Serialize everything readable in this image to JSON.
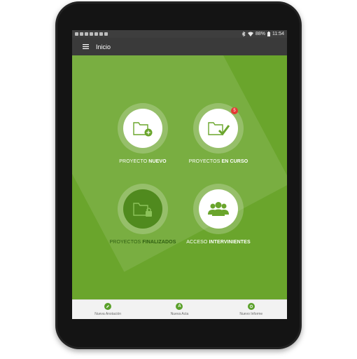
{
  "status_bar": {
    "battery": "88%",
    "time": "11:54"
  },
  "app_bar": {
    "title": "Inicio",
    "menu_icon": "hamburger-menu-icon"
  },
  "tiles": [
    {
      "id": "nuevo",
      "label_prefix": "PROYECTO ",
      "label_bold": "NUEVO",
      "icon": "folder-add-icon",
      "enabled": true
    },
    {
      "id": "en-curso",
      "label_prefix": "PROYECTOS ",
      "label_bold": "EN CURSO",
      "icon": "folder-check-icon",
      "badge": "5",
      "enabled": true
    },
    {
      "id": "finalizados",
      "label_prefix": "PROYECTOS ",
      "label_bold": "FINALIZADOS",
      "icon": "folder-lock-icon",
      "enabled": false
    },
    {
      "id": "intervinientes",
      "label_prefix": "ACCESO ",
      "label_bold": "INTERVINIENTES",
      "icon": "group-icon",
      "enabled": true
    }
  ],
  "bottom_nav": [
    {
      "label": "Nueva Anotación",
      "icon": "pencil-icon"
    },
    {
      "label": "Nueva Acta",
      "icon": "a-icon",
      "glyph": "A"
    },
    {
      "label": "Nuevo Informe",
      "icon": "report-icon"
    }
  ],
  "colors": {
    "primary": "#6aa52c",
    "appbar": "#3a3a3a",
    "badge": "#e53935",
    "disabled_text": "#2f5e12"
  }
}
